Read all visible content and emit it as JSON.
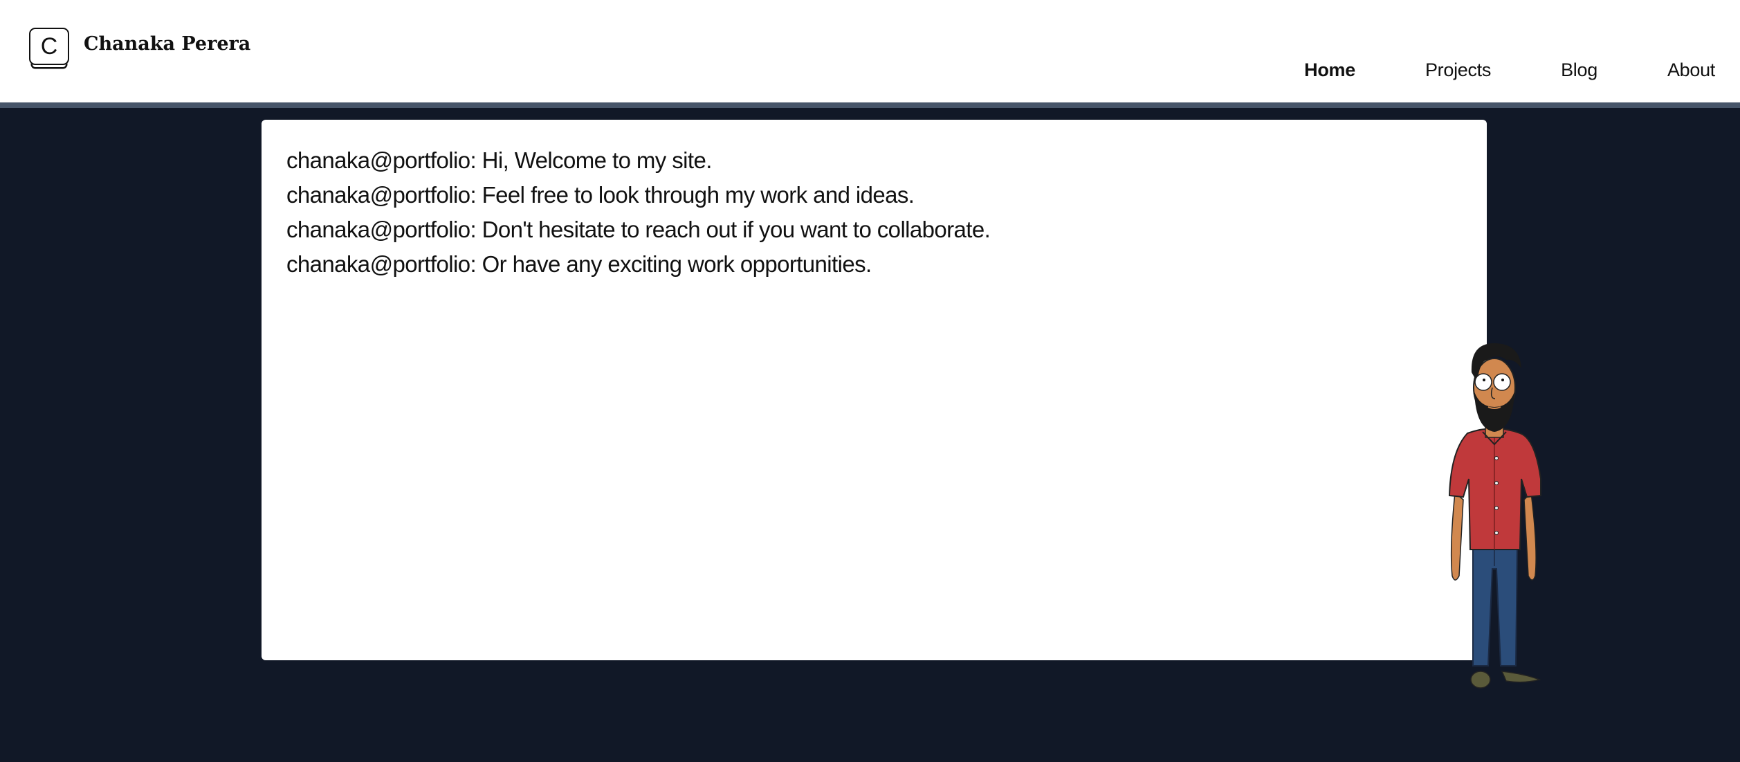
{
  "header": {
    "logo_letter": "C",
    "site_name": "Chanaka Perera"
  },
  "nav": {
    "items": [
      {
        "label": "Home",
        "active": true
      },
      {
        "label": "Projects",
        "active": false
      },
      {
        "label": "Blog",
        "active": false
      },
      {
        "label": "About",
        "active": false
      }
    ]
  },
  "terminal": {
    "lines": [
      "chanaka@portfolio: Hi, Welcome to my site.",
      "chanaka@portfolio: Feel free to look through my work and ideas.",
      "chanaka@portfolio: Don't hesitate to reach out if you want to collaborate.",
      "chanaka@portfolio: Or have any exciting work opportunities."
    ]
  },
  "colors": {
    "background": "#111827",
    "header_border": "#475569",
    "shirt": "#c0393b",
    "pants": "#2b4d7a",
    "skin": "#d1884f"
  }
}
